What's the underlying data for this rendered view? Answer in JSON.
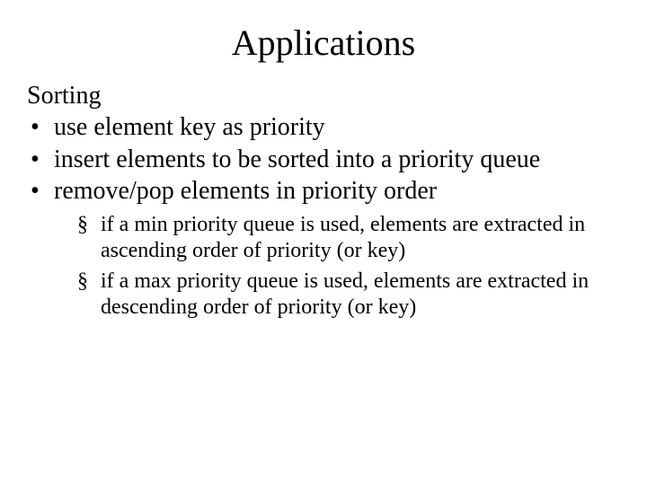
{
  "title": "Applications",
  "section": "Sorting",
  "bullets": [
    "use element key as priority",
    "insert elements to be sorted into a priority queue",
    "remove/pop elements in priority order"
  ],
  "sub_bullets": [
    "if a min priority queue is used, elements are extracted in ascending order of priority (or key)",
    "if a max priority queue is used, elements are extracted in descending order of priority (or key)"
  ]
}
